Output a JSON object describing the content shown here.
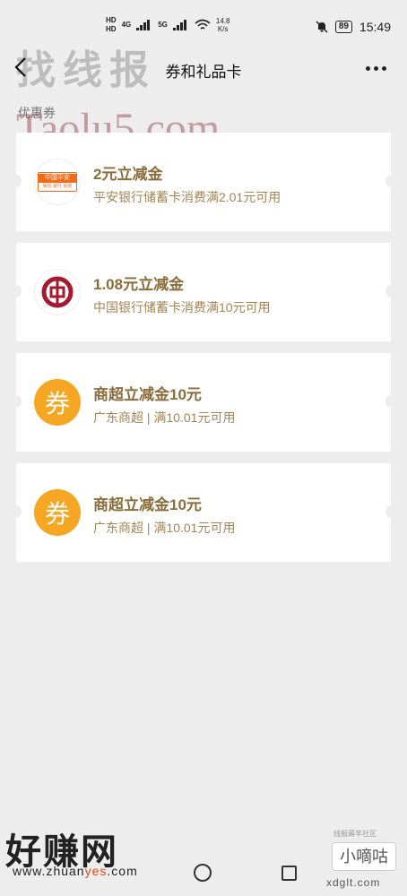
{
  "status_bar": {
    "hd1": "HD",
    "hd2": "HD",
    "net1": "4G",
    "net2": "5G",
    "speed_value": "14.8",
    "speed_unit": "K/s",
    "battery": "89",
    "time": "15:49"
  },
  "navbar": {
    "title": "券和礼品卡"
  },
  "section": {
    "label": "优惠券"
  },
  "coupons": [
    {
      "logo": "pingan-bank-logo",
      "logo_text_main": "中国平安",
      "logo_text_sub": "保险 银行 投资",
      "title": "2元立减金",
      "desc": "平安银行储蓄卡消费满2.01元可用"
    },
    {
      "logo": "boc-bank-logo",
      "title": "1.08元立减金",
      "desc": "中国银行储蓄卡消费满10元可用"
    },
    {
      "logo": "coupon-quan-icon",
      "logo_char": "券",
      "title": "商超立减金10元",
      "desc": "广东商超 | 满10.01元可用"
    },
    {
      "logo": "coupon-quan-icon",
      "logo_char": "券",
      "title": "商超立减金10元",
      "desc": "广东商超 | 满10.01元可用"
    }
  ],
  "watermarks": {
    "top_cn": "找线报",
    "taolu": "Taolu5.com",
    "haozhuan": "好赚网",
    "zhuanyes_a": "www.zhuan",
    "zhuanyes_b": "yes",
    "zhuanyes_c": ".com",
    "xdglt_small": "线报薅羊社区",
    "xdglt_box": "小嘀咕",
    "xdglt_url": "xdglt.com"
  },
  "colors": {
    "background": "#ededed",
    "coupon_title": "#8a6d3b",
    "coupon_desc": "#a48555",
    "quan_orange": "#f5a623",
    "pingan_orange": "#f26b1d",
    "boc_red": "#a6192e"
  }
}
